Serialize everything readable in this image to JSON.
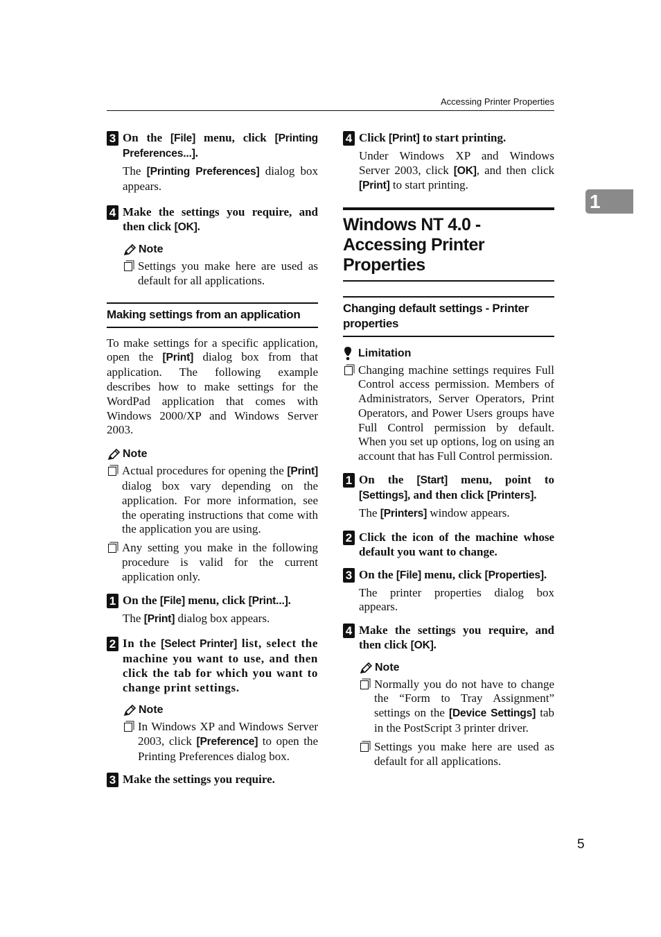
{
  "running_header": "Accessing Printer Properties",
  "chapter_tab": "1",
  "page_number": "5",
  "left_column": {
    "step3": {
      "number": "3",
      "title_parts": [
        "On the ",
        "[File]",
        " menu, click ",
        "[Printing Preferences...]",
        "."
      ],
      "body_parts": [
        "The ",
        "[Printing Preferences]",
        " dialog box appears."
      ]
    },
    "step4": {
      "number": "4",
      "title_parts": [
        "Make the settings you require, and then click ",
        "[OK]",
        "."
      ],
      "note_label": "Note",
      "note_items": [
        "Settings you make here are used as default for all applications."
      ]
    },
    "subsection_title": "Making settings from an application",
    "intro_parts": [
      "To make settings for a specific application, open the ",
      "[Print]",
      " dialog box from that application. The following example describes how to make settings for the WordPad application that comes with Windows 2000/XP and Windows Server 2003."
    ],
    "note_label": "Note",
    "note_item1_parts": [
      "Actual procedures for opening the ",
      "[Print]",
      " dialog box vary depending on the application. For more information, see the operating instructions that come with the application you are using."
    ],
    "note_item2": "Any setting you make in the following procedure is valid for the current application only.",
    "app_step1": {
      "number": "1",
      "title_parts": [
        "On the ",
        "[File]",
        " menu, click ",
        "[Print...]",
        "."
      ],
      "body_parts": [
        "The ",
        "[Print]",
        " dialog box appears."
      ]
    },
    "app_step2": {
      "number": "2",
      "title_parts": [
        "In the ",
        "[Select Printer]",
        " list, select the machine you want to use, and then click the tab for which you want to change print settings."
      ],
      "note_label": "Note",
      "note_item_parts": [
        "In Windows XP and Windows Server 2003, click ",
        "[Preference]",
        " to open the Printing Preferences dialog box."
      ]
    },
    "app_step3": {
      "number": "3",
      "title": "Make the settings you require."
    }
  },
  "right_column": {
    "app_step4": {
      "number": "4",
      "title_parts": [
        "Click ",
        "[Print]",
        " to start printing."
      ],
      "body_parts": [
        "Under Windows XP and Windows Server 2003, click ",
        "[OK]",
        ", and then click ",
        "[Print]",
        " to start printing."
      ]
    },
    "section_title": "Windows NT 4.0 - Accessing Printer Properties",
    "subsection_title": "Changing default settings - Printer properties",
    "limitation_label": "Limitation",
    "limitation_item": "Changing machine settings requires Full Control access permission. Members of Administrators, Server Operators, Print Operators, and Power Users groups have Full Control permission by default. When you set up options, log on using an account that has Full Control permission.",
    "nt_step1": {
      "number": "1",
      "title_parts": [
        "On the ",
        "[Start]",
        " menu, point to ",
        "[Settings]",
        ", and then click ",
        "[Printers]",
        "."
      ],
      "body_parts": [
        "The ",
        "[Printers]",
        " window appears."
      ]
    },
    "nt_step2": {
      "number": "2",
      "title": "Click the icon of the machine whose default you want to change."
    },
    "nt_step3": {
      "number": "3",
      "title_parts": [
        "On the ",
        "[File]",
        " menu, click ",
        "[Properties]",
        "."
      ],
      "body": "The printer properties dialog box appears."
    },
    "nt_step4": {
      "number": "4",
      "title_parts": [
        "Make the settings you require, and then click ",
        "[OK]",
        "."
      ],
      "note_label": "Note",
      "note_item1_parts": [
        "Normally you do not have to change the “Form to Tray Assignment” settings on the ",
        "[Device Settings]",
        " tab in the PostScript 3 printer driver."
      ],
      "note_item2": "Settings you make here are used as default for all applications."
    }
  }
}
